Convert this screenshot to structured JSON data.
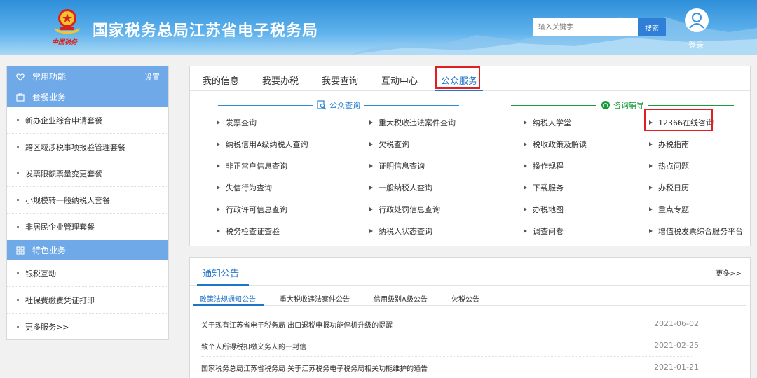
{
  "header": {
    "site_title": "国家税务总局江苏省电子税务局",
    "brand_signature": "中国税务",
    "search_placeholder": "输入关键字",
    "search_button": "搜索",
    "login_label": "登录"
  },
  "sidebar": {
    "common_functions": "常用功能",
    "settings": "设置",
    "package_section": "套餐业务",
    "package_items": [
      "新办企业综合申请套餐",
      "跨区域涉税事项报验管理套餐",
      "发票限额票量变更套餐",
      "小规模转一般纳税人套餐",
      "非居民企业管理套餐"
    ],
    "special_section": "特色业务",
    "special_items": [
      "银税互动",
      "社保费缴费凭证打印",
      "更多服务>>"
    ]
  },
  "main_tabs": [
    "我的信息",
    "我要办税",
    "我要查询",
    "互动中心",
    "公众服务"
  ],
  "active_tab": "公众服务",
  "public_query": {
    "heading": "公众查询",
    "col1": [
      "发票查询",
      "纳税信用A级纳税人查询",
      "非正常户信息查询",
      "失信行为查询",
      "行政许可信息查询",
      "税务检查证查验"
    ],
    "col2": [
      "重大税收违法案件查询",
      "欠税查询",
      "证明信息查询",
      "一般纳税人查询",
      "行政处罚信息查询",
      "纳税人状态查询"
    ]
  },
  "consult_guide": {
    "heading": "咨询辅导",
    "col1": [
      "纳税人学堂",
      "税收政策及解读",
      "操作规程",
      "下载服务",
      "办税地图",
      "调查问卷"
    ],
    "col2": [
      "12366在线咨询",
      "办税指南",
      "热点问题",
      "办税日历",
      "重点专题",
      "增值税发票综合服务平台"
    ]
  },
  "notices": {
    "title": "通知公告",
    "more": "更多>>",
    "subtabs": [
      "政策法规通知公告",
      "重大税收违法案件公告",
      "信用级别A级公告",
      "欠税公告"
    ],
    "items": [
      {
        "title": "关于现有江苏省电子税务局 出口退税申报功能停机升级的提醒",
        "date": "2021-06-02"
      },
      {
        "title": "致个人所得税扣缴义务人的一封信",
        "date": "2021-02-25"
      },
      {
        "title": "国家税务总局江苏省税务局 关于江苏税务电子税务局相关功能维护的通告",
        "date": "2021-01-21"
      }
    ]
  },
  "colors": {
    "accent_blue": "#1f74c8",
    "sidebar_header": "#6fa9e8",
    "highlight_red": "#e02020",
    "consult_green": "#1a9a3a"
  }
}
